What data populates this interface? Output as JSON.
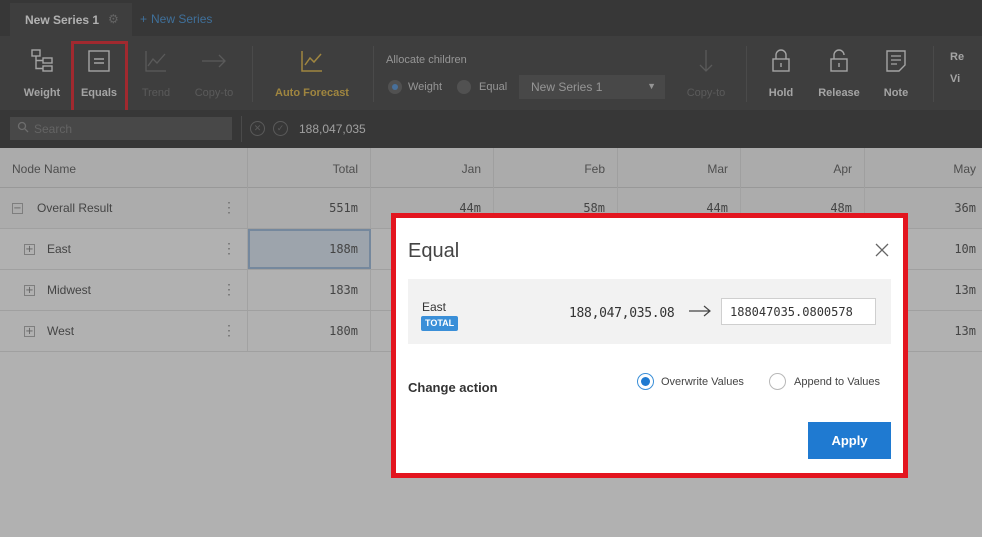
{
  "tabs": {
    "active": "New Series 1",
    "new_tab": "New Series"
  },
  "toolbar": {
    "weight": "Weight",
    "equals": "Equals",
    "trend": "Trend",
    "copy_to": "Copy-to",
    "auto_forecast": "Auto Forecast",
    "allocate_title": "Allocate children",
    "alloc_weight": "Weight",
    "alloc_equal": "Equal",
    "selected_alloc": "Weight",
    "series_select": "New Series 1",
    "copy_to_2": "Copy-to",
    "hold": "Hold",
    "release": "Release",
    "note": "Note",
    "right_1": "Re",
    "right_2": "Vi"
  },
  "search": {
    "placeholder": "Search",
    "value": "188,047,035"
  },
  "grid": {
    "columns": [
      "Node Name",
      "Total",
      "Jan",
      "Feb",
      "Mar",
      "Apr",
      "May"
    ],
    "rows": [
      {
        "name": "Overall Result",
        "expander": "−",
        "values": [
          "551m",
          "44m",
          "58m",
          "44m",
          "48m",
          "36m"
        ]
      },
      {
        "name": "East",
        "expander": "+",
        "values": [
          "188m",
          "",
          "",
          "",
          "",
          "10m"
        ]
      },
      {
        "name": "Midwest",
        "expander": "+",
        "values": [
          "183m",
          "",
          "",
          "",
          "",
          "13m"
        ]
      },
      {
        "name": "West",
        "expander": "+",
        "values": [
          "180m",
          "",
          "",
          "",
          "",
          "13m"
        ]
      }
    ]
  },
  "dialog": {
    "title": "Equal",
    "node_name": "East",
    "badge": "TOTAL",
    "original_value": "188,047,035.08",
    "new_value": "188047035.0800578",
    "change_action_label": "Change action",
    "option_overwrite": "Overwrite Values",
    "option_append": "Append to Values",
    "selected_option": "Overwrite Values",
    "apply": "Apply"
  },
  "colors": {
    "highlight": "#e3151f",
    "accent": "#1f7ad1",
    "auto_forecast": "#e0b43c"
  },
  "icons": [
    "gear-icon",
    "weight-icon",
    "equals-icon",
    "trend-icon",
    "copy-to-icon",
    "auto-forecast-icon",
    "down-arrow-icon",
    "lock-icon",
    "unlock-icon",
    "note-icon",
    "search-icon",
    "close-icon",
    "arrow-right-icon"
  ]
}
